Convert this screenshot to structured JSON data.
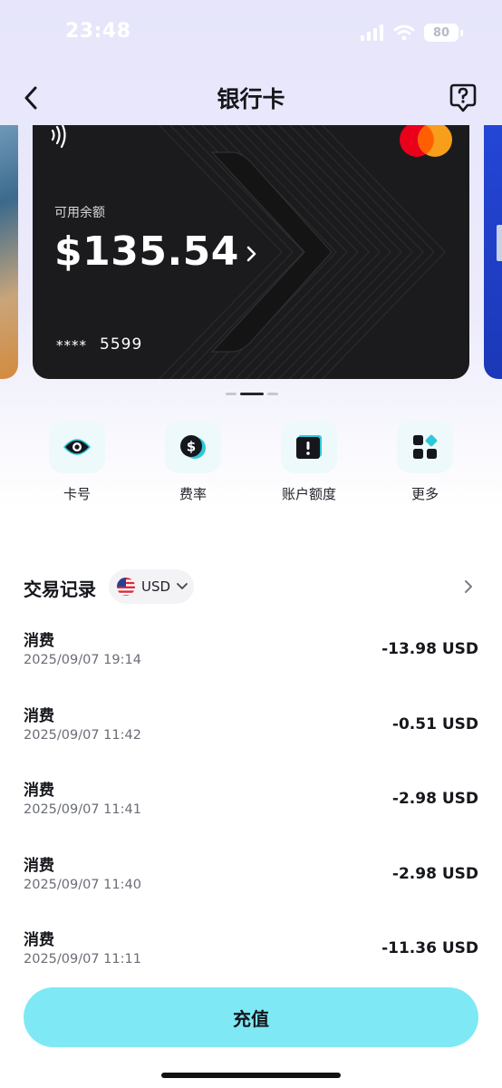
{
  "status_bar": {
    "time": "23:48",
    "battery": "80"
  },
  "header": {
    "title": "银行卡"
  },
  "card": {
    "balance_label": "可用余额",
    "balance": "$135.54",
    "mask": "****",
    "last4": "5599",
    "brand_icon": "mastercard-logo",
    "colors": {
      "card_bg": "#1b1b1d",
      "mc_red": "#eb001b",
      "mc_orange": "#f79e1b"
    }
  },
  "carousel": {
    "page_count": 3,
    "active_index": 1
  },
  "actions": [
    {
      "label": "卡号",
      "icon": "eye-icon"
    },
    {
      "label": "费率",
      "icon": "dollar-circle-icon"
    },
    {
      "label": "账户额度",
      "icon": "limit-icon"
    },
    {
      "label": "更多",
      "icon": "grid-icon"
    }
  ],
  "transactions": {
    "title": "交易记录",
    "currency": "USD",
    "currency_flag": "us-flag-icon",
    "items": [
      {
        "type": "消费",
        "date": "2025/09/07 19:14",
        "amount": "-13.98 USD"
      },
      {
        "type": "消费",
        "date": "2025/09/07 11:42",
        "amount": "-0.51 USD"
      },
      {
        "type": "消费",
        "date": "2025/09/07 11:41",
        "amount": "-2.98 USD"
      },
      {
        "type": "消费",
        "date": "2025/09/07 11:40",
        "amount": "-2.98 USD"
      },
      {
        "type": "消费",
        "date": "2025/09/07 11:11",
        "amount": "-11.36 USD"
      }
    ]
  },
  "topup": {
    "label": "充值",
    "color": "#7ee9f5"
  },
  "accent_color": "#2fc7d6"
}
